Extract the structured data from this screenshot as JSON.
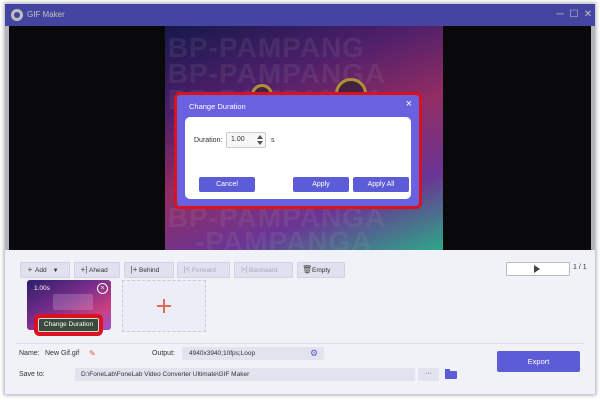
{
  "window": {
    "title": "GIF Maker",
    "controls": {
      "minimize": "─",
      "maximize": "☐",
      "close": "✕"
    }
  },
  "preview": {
    "watermark_lines": [
      "IBP-PAMPANG",
      "IBP-PAMPANGA",
      "IBP-PAMPANGA",
      "IBP-PAMPANGA",
      "-PAMPANGA"
    ]
  },
  "dialog": {
    "title": "Change Duration",
    "duration_label": "Duration:",
    "duration_value": "1.00",
    "unit": "s",
    "cancel_label": "Cancel",
    "apply_label": "Apply",
    "apply_all_label": "Apply All"
  },
  "toolbar": {
    "add_label": "Add",
    "ahead_label": "Ahead",
    "behind_label": "Behind",
    "forward_label": "Forward",
    "backward_label": "Backward",
    "empty_label": "Empty",
    "page_indicator": "1 / 1"
  },
  "timeline": {
    "clip_duration": "1.00s",
    "change_duration_label": "Change Duration"
  },
  "footer": {
    "name_label": "Name:",
    "name_value": "New Gif.gif",
    "output_label": "Output:",
    "output_value": "4940x3940;10fps;Loop",
    "save_to_label": "Save to:",
    "save_path": "D:\\FoneLab\\FoneLab Video Converter Ultimate\\GIF Maker",
    "more_label": "···",
    "export_label": "Export"
  },
  "colors": {
    "accent": "#5b5cd6",
    "highlight_red": "#d8121f"
  }
}
